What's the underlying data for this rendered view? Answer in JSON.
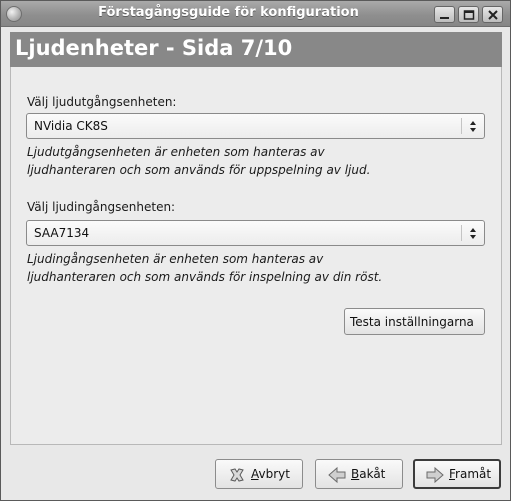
{
  "window": {
    "title": "Förstagångsguide för konfiguration"
  },
  "header": {
    "title": "Ljudenheter - Sida 7/10"
  },
  "output": {
    "label": "Välj ljudutgångsenheten:",
    "selected": "NVidia CK8S",
    "description_line1": "Ljudutgångsenheten är enheten som hanteras av",
    "description_line2": "ljudhanteraren och som används för uppspelning av ljud."
  },
  "input": {
    "label": "Välj ljudingångsenheten:",
    "selected": "SAA7134",
    "description_line1": "Ljudingångsenheten är enheten som hanteras av",
    "description_line2": "ljudhanteraren och som används för inspelning av din röst."
  },
  "test_button": {
    "label": "Testa inställningarna"
  },
  "footer": {
    "cancel_mnemonic": "A",
    "cancel_rest": "vbryt",
    "back_mnemonic": "B",
    "back_rest": "akåt",
    "next_mnemonic": "F",
    "next_rest": "ramåt"
  },
  "icons": {
    "window_menu": "app-menu-icon",
    "minimize": "minimize-icon",
    "maximize": "maximize-icon",
    "close": "close-icon",
    "cancel": "cancel-icon",
    "back": "back-arrow-icon",
    "next": "forward-arrow-icon"
  }
}
